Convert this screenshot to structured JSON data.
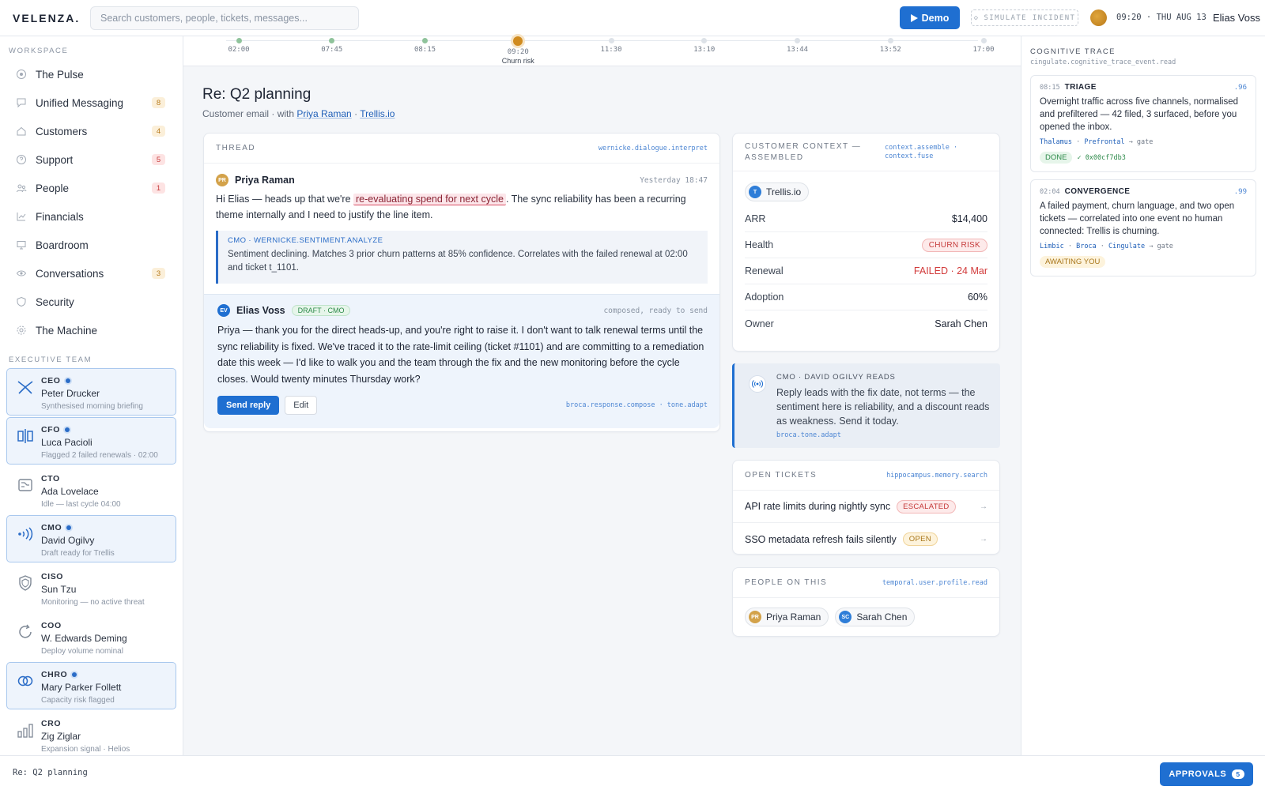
{
  "app": {
    "logo": "VELENZA.",
    "search_placeholder": "Search customers, people, tickets, messages..."
  },
  "header": {
    "demo_label": "Demo",
    "simulate_label": "SIMULATE INCIDENT",
    "clock": "09:20 · THU AUG 13",
    "user_name": "Elias Voss"
  },
  "sidebar": {
    "workspace_label": "WORKSPACE",
    "items": [
      {
        "label": "The Pulse",
        "icon": "pulse-icon"
      },
      {
        "label": "Unified Messaging",
        "icon": "message-icon",
        "count": "8",
        "count_color": "amber"
      },
      {
        "label": "Customers",
        "icon": "home-icon",
        "count": "4",
        "count_color": "amber"
      },
      {
        "label": "Support",
        "icon": "help-icon",
        "count": "5",
        "count_color": "red"
      },
      {
        "label": "People",
        "icon": "people-icon",
        "count": "1",
        "count_color": "red"
      },
      {
        "label": "Financials",
        "icon": "chart-icon"
      },
      {
        "label": "Boardroom",
        "icon": "monitor-icon"
      },
      {
        "label": "Conversations",
        "icon": "eye-icon",
        "count": "3",
        "count_color": "amber"
      },
      {
        "label": "Security",
        "icon": "shield-icon"
      },
      {
        "label": "The Machine",
        "icon": "gear-icon"
      }
    ],
    "exec_label": "EXECUTIVE TEAM",
    "execs": [
      {
        "role": "CEO",
        "name": "Peter Drucker",
        "status": "Synthesised morning briefing",
        "active": true,
        "icon": "compass-icon"
      },
      {
        "role": "CFO",
        "name": "Luca Pacioli",
        "status": "Flagged 2 failed renewals · 02:00",
        "active": true,
        "icon": "balance-icon"
      },
      {
        "role": "CTO",
        "name": "Ada Lovelace",
        "status": "Idle — last cycle 04:00",
        "active": false,
        "icon": "circuit-icon"
      },
      {
        "role": "CMO",
        "name": "David Ogilvy",
        "status": "Draft ready for Trellis",
        "active": true,
        "icon": "broadcast-icon"
      },
      {
        "role": "CISO",
        "name": "Sun Tzu",
        "status": "Monitoring — no active threat",
        "active": false,
        "icon": "shield-icon"
      },
      {
        "role": "COO",
        "name": "W. Edwards Deming",
        "status": "Deploy volume nominal",
        "active": false,
        "icon": "cycle-icon"
      },
      {
        "role": "CHRO",
        "name": "Mary Parker Follett",
        "status": "Capacity risk flagged",
        "active": true,
        "icon": "rings-icon"
      },
      {
        "role": "CRO",
        "name": "Zig Ziglar",
        "status": "Expansion signal · Helios",
        "active": false,
        "icon": "bars-icon"
      }
    ]
  },
  "timeline": {
    "ticks": [
      {
        "time": "02:00",
        "state": "past"
      },
      {
        "time": "07:45",
        "state": "past"
      },
      {
        "time": "08:15",
        "state": "past"
      },
      {
        "time": "09:20",
        "state": "now",
        "note": "Churn risk"
      },
      {
        "time": "11:30",
        "state": "future"
      },
      {
        "time": "13:10",
        "state": "future"
      },
      {
        "time": "13:44",
        "state": "future"
      },
      {
        "time": "13:52",
        "state": "future"
      },
      {
        "time": "17:00",
        "state": "future"
      }
    ]
  },
  "page": {
    "title": "Re: Q2 planning",
    "sub_prefix": "Customer email · with",
    "contact": "Priya Raman",
    "company": "Trellis.io"
  },
  "thread": {
    "title": "THREAD",
    "tag": "wernicke.dialogue.interpret",
    "message": {
      "initials": "PR",
      "from": "Priya Raman",
      "time": "Yesterday 18:47",
      "body_before": "Hi Elias — heads up that we're",
      "highlight": "re-evaluating spend for next cycle",
      "body_after": ". The sync reliability has been a recurring theme internally and I need to justify the line item."
    },
    "insight": {
      "tag": "CMO · WERNICKE.SENTIMENT.ANALYZE",
      "text": "Sentiment declining. Matches 3 prior churn patterns at 85% confidence. Correlates with the failed renewal at 02:00 and ticket t_1101."
    },
    "draft": {
      "initials": "EV",
      "from": "Elias Voss",
      "pill": "DRAFT · CMO",
      "status": "composed, ready to send",
      "body": "Priya — thank you for the direct heads-up, and you're right to raise it. I don't want to talk renewal terms until the sync reliability is fixed. We've traced it to the rate-limit ceiling (ticket #1101) and are committing to a remediation date this week — I'd like to walk you and the team through the fix and the new monitoring before the cycle closes. Would twenty minutes Thursday work?",
      "send_label": "Send reply",
      "edit_label": "Edit",
      "tags": "broca.response.compose · tone.adapt"
    }
  },
  "context": {
    "title": "CUSTOMER CONTEXT — ASSEMBLED",
    "tag": "context.assemble · context.fuse",
    "company_initial": "T",
    "company": "Trellis.io",
    "rows": [
      {
        "k": "ARR",
        "v": "$14,400"
      },
      {
        "k": "Health",
        "v": "CHURN RISK"
      },
      {
        "k": "Renewal",
        "v": "FAILED · 24 Mar"
      },
      {
        "k": "Adoption",
        "v": "60%"
      },
      {
        "k": "Owner",
        "v": "Sarah Chen"
      }
    ]
  },
  "cmo_note": {
    "title": "CMO · DAVID OGILVY READS",
    "text": "Reply leads with the fix date, not terms — the sentiment here is reliability, and a discount reads as weakness. Send it today.",
    "tag": "broca.tone.adapt"
  },
  "tickets": {
    "title": "OPEN TICKETS",
    "tag": "hippocampus.memory.search",
    "items": [
      {
        "title": "API rate limits during nightly sync",
        "badge": "ESCALATED"
      },
      {
        "title": "SSO metadata refresh fails silently",
        "badge": "OPEN"
      }
    ]
  },
  "people": {
    "title": "PEOPLE ON THIS",
    "tag": "temporal.user.profile.read",
    "items": [
      {
        "initials": "PR",
        "name": "Priya Raman"
      },
      {
        "initials": "SC",
        "name": "Sarah Chen"
      }
    ]
  },
  "trace": {
    "title": "COGNITIVE TRACE",
    "sub": "cingulate.cognitive_trace_event.read",
    "events": [
      {
        "time": "08:15",
        "name": "TRIAGE",
        "score": ".96",
        "text": "Overnight traffic across five channels, normalised and prefiltered — 42 filed, 3 surfaced, before you opened the inbox.",
        "links": [
          "Thalamus",
          "Prefrontal"
        ],
        "gate": "→ gate",
        "status": "DONE",
        "hash": "✓ 0x00cf7db3"
      },
      {
        "time": "02:04",
        "name": "CONVERGENCE",
        "score": ".99",
        "text": "A failed payment, churn language, and two open tickets — correlated into one event no human connected: Trellis is churning.",
        "links": [
          "Limbic",
          "Broca",
          "Cingulate"
        ],
        "gate": "→ gate",
        "status": "AWAITING YOU"
      }
    ]
  },
  "footer": {
    "context": "Re: Q2 planning",
    "approvals_label": "APPROVALS",
    "approvals_count": "5"
  },
  "colors": {
    "accent": "#1f6fd1",
    "danger": "#d23a3a",
    "warning": "#d08b1f",
    "success": "#2d8a4a"
  }
}
